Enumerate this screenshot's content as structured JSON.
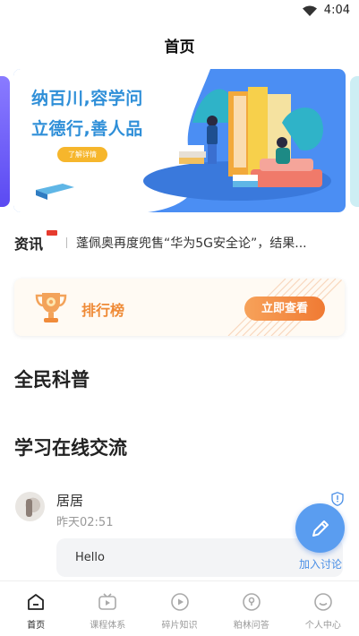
{
  "status_bar": {
    "time": "4:04",
    "wifi_icon": "wifi-icon"
  },
  "header": {
    "title": "首页"
  },
  "banner": {
    "line1": "纳百川,容学问",
    "line2": "立德行,善人品",
    "button_label": "了解详情"
  },
  "news": {
    "badge": "资讯",
    "headline": "蓬佩奥再度兜售“华为5G安全论”，结果..."
  },
  "ranking": {
    "label": "排行榜",
    "button_label": "立即查看"
  },
  "sections": {
    "science": "全民科普",
    "exchange": "学习在线交流"
  },
  "post": {
    "author": "居居",
    "time": "昨天02:51",
    "content": "Hello"
  },
  "fab": {
    "label": "加入讨论",
    "icon": "pencil-icon"
  },
  "tabs": [
    {
      "label": "首页",
      "icon": "home-icon",
      "active": true
    },
    {
      "label": "课程体系",
      "icon": "course-icon",
      "active": false
    },
    {
      "label": "碎片知识",
      "icon": "play-icon",
      "active": false
    },
    {
      "label": "粕林问答",
      "icon": "qa-icon",
      "active": false
    },
    {
      "label": "个人中心",
      "icon": "profile-icon",
      "active": false
    }
  ],
  "colors": {
    "accent_blue": "#5a9df0",
    "banner_blue": "#4b8ef3",
    "rank_orange": "#ef8a36"
  }
}
